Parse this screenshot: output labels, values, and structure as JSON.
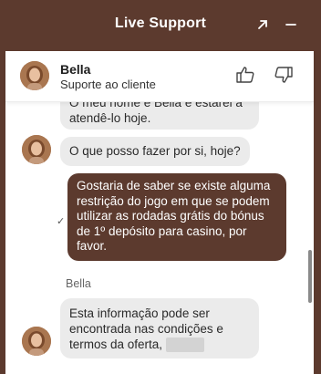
{
  "window": {
    "title": "Live Support"
  },
  "agent": {
    "name": "Bella",
    "role": "Suporte ao cliente"
  },
  "messages": {
    "greeting_tail": "O meu nome é Bella e estarei a atendê-lo hoje.",
    "question": "O que posso fazer por si, hoje?",
    "user_message": "Gostaria de saber se existe alguma restrição do jogo em que se podem utilizar as rodadas grátis do bónus de 1º depósito para casino, por favor.",
    "sender_label": "Bella",
    "reply": "Esta informação pode ser encontrada nas condições e termos da oferta,"
  },
  "colors": {
    "brand": "#5c3a2e",
    "incoming_bubble": "#ebebeb",
    "outgoing_bubble": "#5c3a2e"
  },
  "icons": {
    "expand": "expand-icon",
    "minimize": "minimize-icon",
    "thumbs_up": "thumbs-up-icon",
    "thumbs_down": "thumbs-down-icon",
    "sent_check": "check-icon"
  }
}
